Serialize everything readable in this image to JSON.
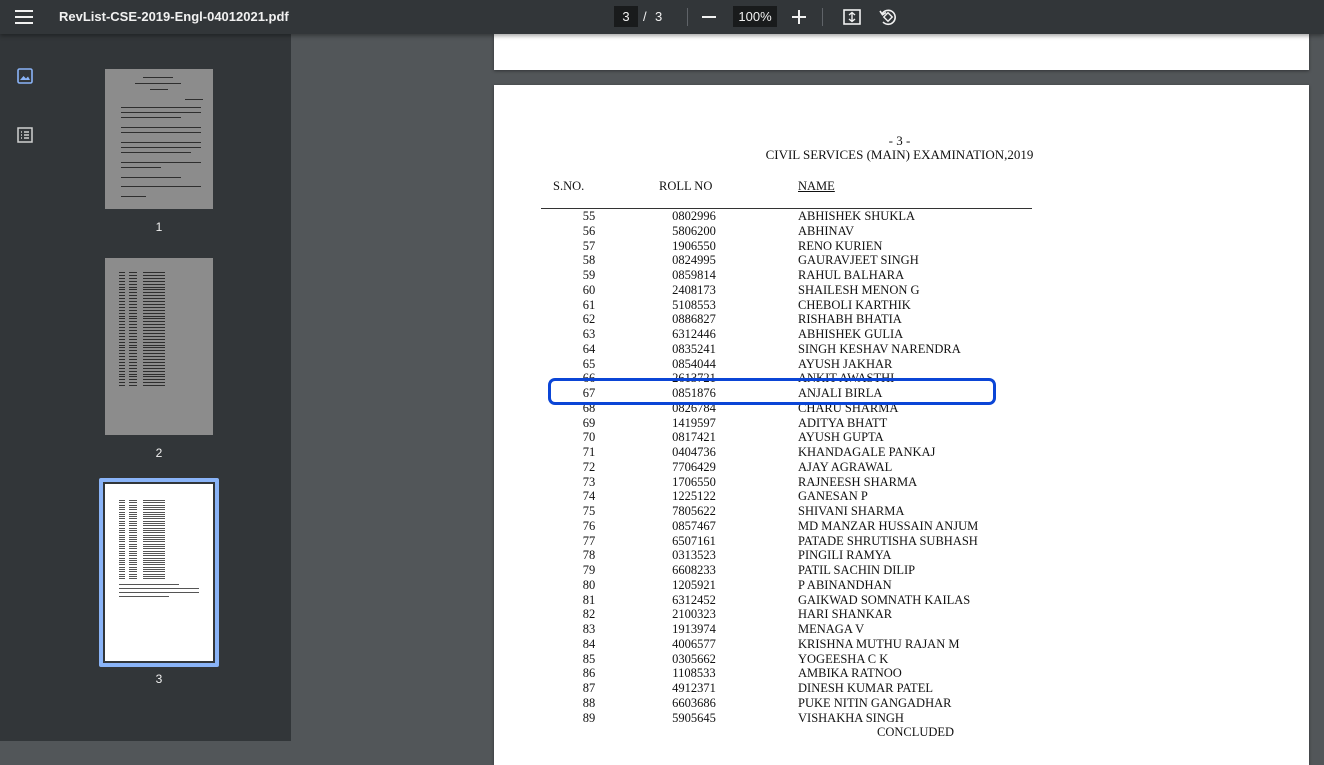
{
  "toolbar": {
    "title": "RevList-CSE-2019-Engl-04012021.pdf",
    "current_page": "3",
    "page_separator": "/",
    "total_pages": "3",
    "zoom": "100%"
  },
  "sidebar": {
    "thumbnails": [
      {
        "label": "1"
      },
      {
        "label": "2"
      },
      {
        "label": "3",
        "selected": true
      }
    ]
  },
  "document": {
    "page_number": "- 3 -",
    "exam_title": "CIVIL SERVICES (MAIN) EXAMINATION,2019",
    "headers": {
      "sno": "S.NO.",
      "roll": "ROLL NO",
      "name": "NAME"
    },
    "rows": [
      {
        "sno": "55",
        "roll": "0802996",
        "name": "ABHISHEK SHUKLA"
      },
      {
        "sno": "56",
        "roll": "5806200",
        "name": "ABHINAV"
      },
      {
        "sno": "57",
        "roll": "1906550",
        "name": "RENO KURIEN"
      },
      {
        "sno": "58",
        "roll": "0824995",
        "name": "GAURAVJEET SINGH"
      },
      {
        "sno": "59",
        "roll": "0859814",
        "name": "RAHUL BALHARA"
      },
      {
        "sno": "60",
        "roll": "2408173",
        "name": "SHAILESH MENON G"
      },
      {
        "sno": "61",
        "roll": "5108553",
        "name": "CHEBOLI KARTHIK"
      },
      {
        "sno": "62",
        "roll": "0886827",
        "name": "RISHABH BHATIA"
      },
      {
        "sno": "63",
        "roll": "6312446",
        "name": "ABHISHEK GULIA"
      },
      {
        "sno": "64",
        "roll": "0835241",
        "name": "SINGH KESHAV NARENDRA"
      },
      {
        "sno": "65",
        "roll": "0854044",
        "name": "AYUSH JAKHAR"
      },
      {
        "sno": "66",
        "roll": "2613721",
        "name": "ANKIT AWASTHI"
      },
      {
        "sno": "67",
        "roll": "0851876",
        "name": "ANJALI BIRLA"
      },
      {
        "sno": "68",
        "roll": "0826784",
        "name": "CHARU SHARMA"
      },
      {
        "sno": "69",
        "roll": "1419597",
        "name": "ADITYA BHATT"
      },
      {
        "sno": "70",
        "roll": "0817421",
        "name": "AYUSH GUPTA"
      },
      {
        "sno": "71",
        "roll": "0404736",
        "name": "KHANDAGALE PANKAJ"
      },
      {
        "sno": "72",
        "roll": "7706429",
        "name": "AJAY AGRAWAL"
      },
      {
        "sno": "73",
        "roll": "1706550",
        "name": "RAJNEESH SHARMA"
      },
      {
        "sno": "74",
        "roll": "1225122",
        "name": "GANESAN P"
      },
      {
        "sno": "75",
        "roll": "7805622",
        "name": "SHIVANI SHARMA"
      },
      {
        "sno": "76",
        "roll": "0857467",
        "name": "MD MANZAR HUSSAIN ANJUM"
      },
      {
        "sno": "77",
        "roll": "6507161",
        "name": "PATADE SHRUTISHA SUBHASH"
      },
      {
        "sno": "78",
        "roll": "0313523",
        "name": "PINGILI RAMYA"
      },
      {
        "sno": "79",
        "roll": "6608233",
        "name": "PATIL SACHIN DILIP"
      },
      {
        "sno": "80",
        "roll": "1205921",
        "name": "P ABINANDHAN"
      },
      {
        "sno": "81",
        "roll": "6312452",
        "name": "GAIKWAD SOMNATH KAILAS"
      },
      {
        "sno": "82",
        "roll": "2100323",
        "name": "HARI SHANKAR"
      },
      {
        "sno": "83",
        "roll": "1913974",
        "name": "MENAGA V"
      },
      {
        "sno": "84",
        "roll": "4006577",
        "name": "KRISHNA MUTHU RAJAN M"
      },
      {
        "sno": "85",
        "roll": "0305662",
        "name": "YOGEESHA C K"
      },
      {
        "sno": "86",
        "roll": "1108533",
        "name": "AMBIKA RATNOO"
      },
      {
        "sno": "87",
        "roll": "4912371",
        "name": "DINESH KUMAR PATEL"
      },
      {
        "sno": "88",
        "roll": "6603686",
        "name": "PUKE NITIN GANGADHAR"
      },
      {
        "sno": "89",
        "roll": "5905645",
        "name": "VISHAKHA SINGH"
      }
    ],
    "footer": "CONCLUDED",
    "highlighted_sno": "67"
  },
  "colors": {
    "toolbar_bg": "#323639",
    "viewer_bg": "#525659",
    "selection": "#8ab4f8",
    "highlight": "#0b45d6"
  }
}
